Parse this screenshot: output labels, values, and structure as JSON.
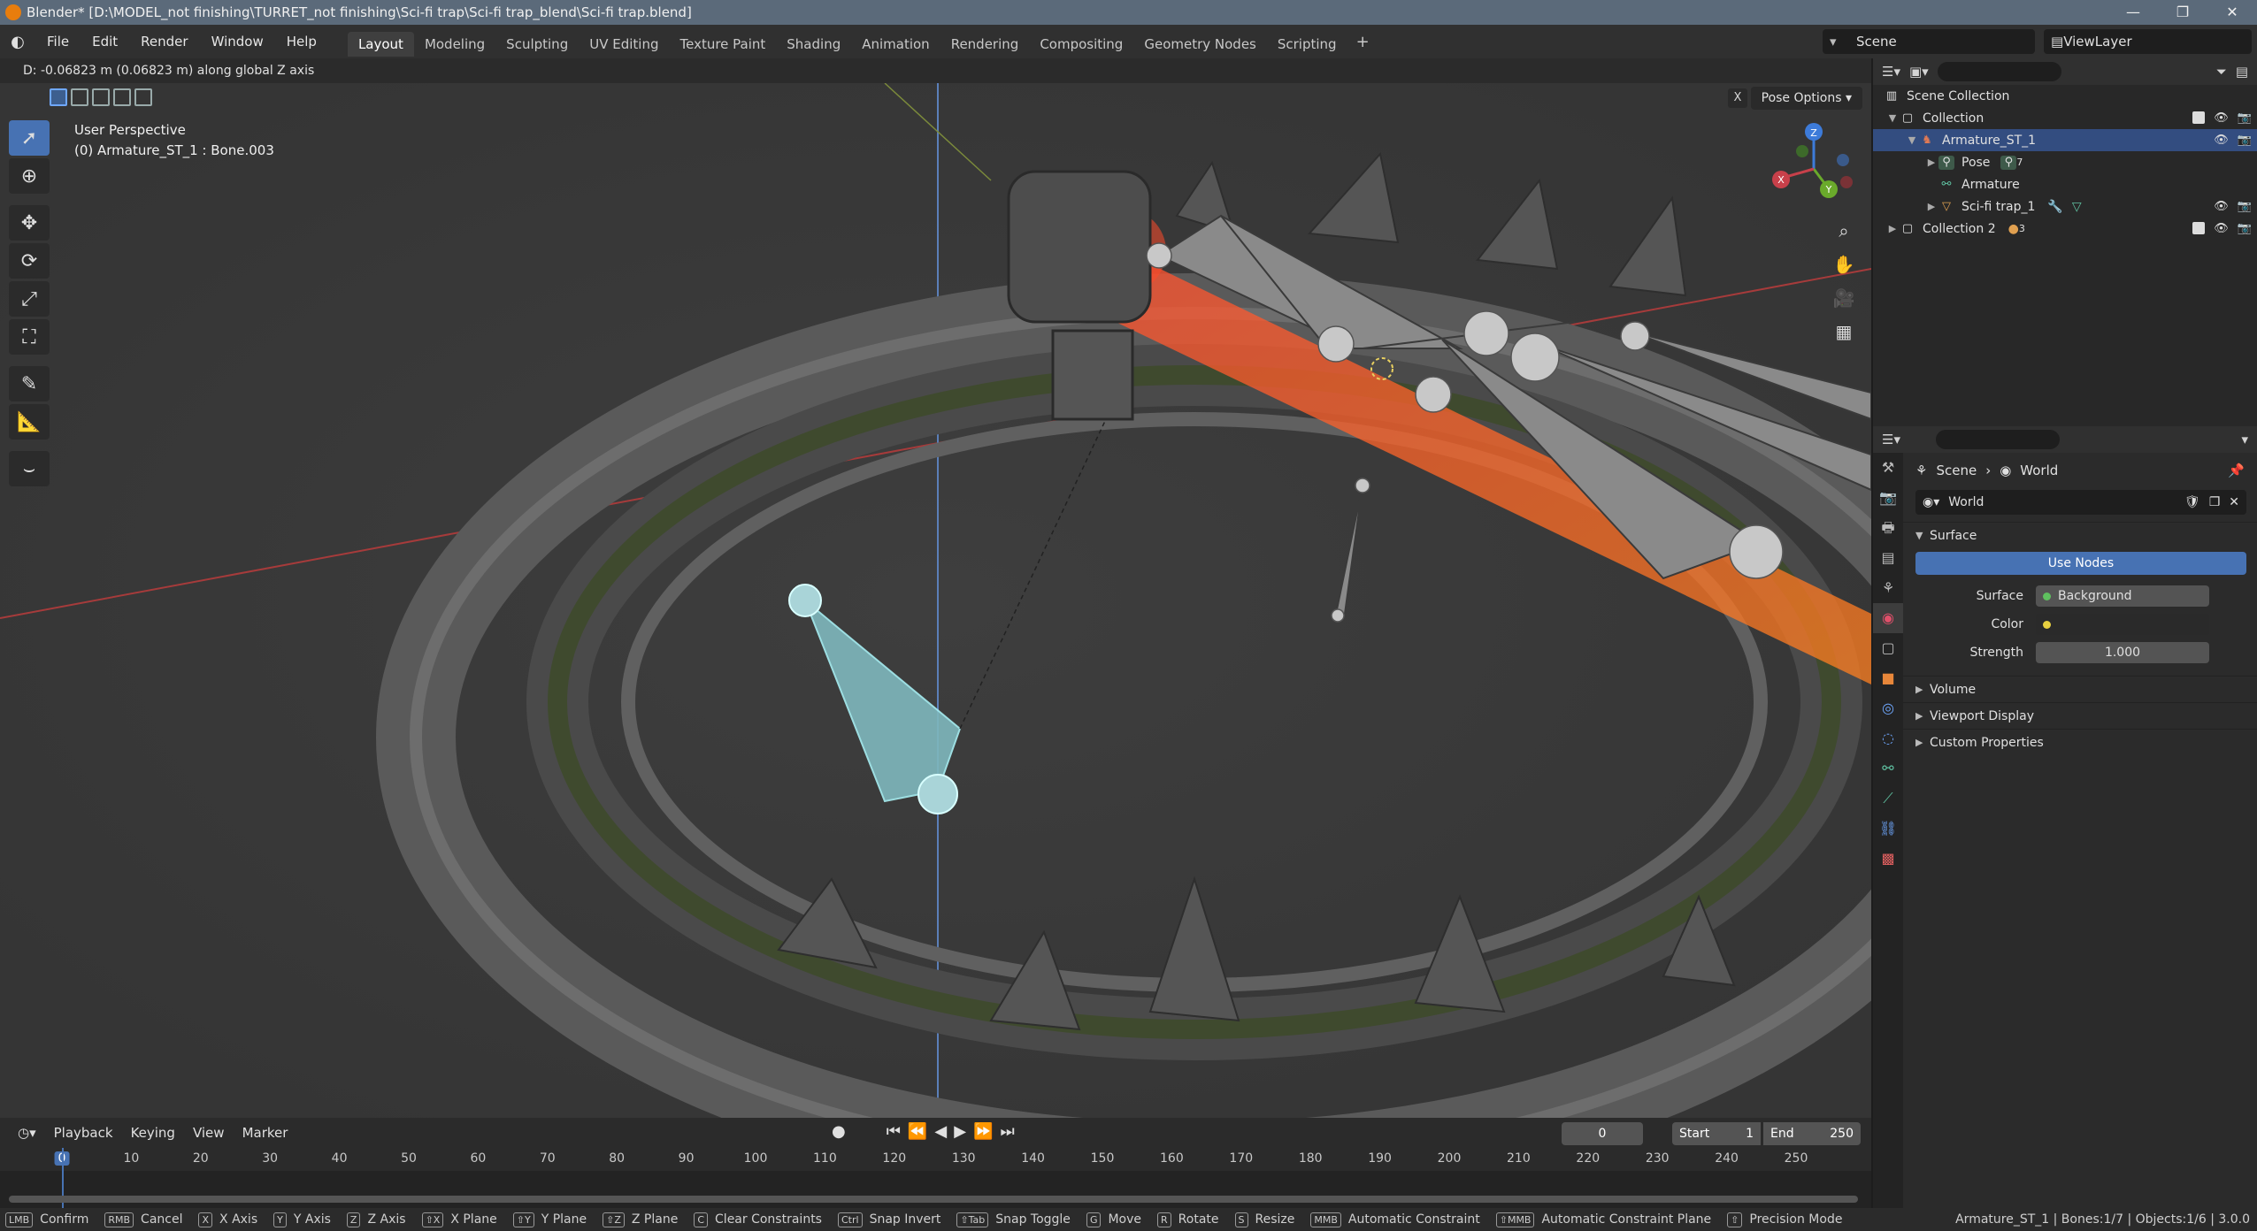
{
  "window": {
    "title": "Blender* [D:\\MODEL_not finishing\\TURRET_not finishing\\Sci-fi trap\\Sci-fi trap_blend\\Sci-fi trap.blend]",
    "controls": [
      "—",
      "❐",
      "✕"
    ]
  },
  "menubar": {
    "menus": [
      "File",
      "Edit",
      "Render",
      "Window",
      "Help"
    ],
    "workspaces": [
      "Layout",
      "Modeling",
      "Sculpting",
      "UV Editing",
      "Texture Paint",
      "Shading",
      "Animation",
      "Rendering",
      "Compositing",
      "Geometry Nodes",
      "Scripting"
    ],
    "active_workspace": "Layout",
    "add": "+",
    "scene": "Scene",
    "view_layer": "ViewLayer"
  },
  "header_status": "D: -0.06823 m (0.06823 m) along global Z axis",
  "viewport": {
    "perspective": "User Perspective",
    "active_bone": "(0) Armature_ST_1 : Bone.003",
    "pose_options": "Pose Options",
    "xray_label": "X",
    "gizmo": {
      "x": "X",
      "y": "Y",
      "z": "Z"
    }
  },
  "timeline": {
    "menus": [
      "Playback",
      "Keying",
      "View",
      "Marker"
    ],
    "current_frame": "0",
    "start_label": "Start",
    "start": "1",
    "end_label": "End",
    "end": "250",
    "ticks": [
      "0",
      "10",
      "20",
      "30",
      "40",
      "50",
      "60",
      "70",
      "80",
      "90",
      "100",
      "110",
      "120",
      "130",
      "140",
      "150",
      "160",
      "170",
      "180",
      "190",
      "200",
      "210",
      "220",
      "230",
      "240",
      "250"
    ]
  },
  "outliner": {
    "rows": [
      {
        "label": "Scene Collection"
      },
      {
        "label": "Collection"
      },
      {
        "label": "Armature_ST_1"
      },
      {
        "label": "Pose"
      },
      {
        "label": "Armature"
      },
      {
        "label": "Sci-fi trap_1"
      },
      {
        "label": "Collection 2"
      }
    ],
    "pose_badge": "7",
    "collection2_badge": "3"
  },
  "properties": {
    "breadcrumb": {
      "scene": "Scene",
      "world": "World"
    },
    "world_name": "World",
    "surface_panel": "Surface",
    "use_nodes": "Use Nodes",
    "surface_label": "Surface",
    "surface_value": "Background",
    "color_label": "Color",
    "strength_label": "Strength",
    "strength_value": "1.000",
    "panels": [
      "Volume",
      "Viewport Display",
      "Custom Properties"
    ]
  },
  "bottombar": {
    "hints": [
      {
        "key": "LMB",
        "label": "Confirm"
      },
      {
        "key": "RMB",
        "label": "Cancel"
      },
      {
        "key": "X",
        "label": "X Axis"
      },
      {
        "key": "Y",
        "label": "Y Axis"
      },
      {
        "key": "Z",
        "label": "Z Axis"
      },
      {
        "key": "⇧X",
        "label": "X Plane"
      },
      {
        "key": "⇧Y",
        "label": "Y Plane"
      },
      {
        "key": "⇧Z",
        "label": "Z Plane"
      },
      {
        "key": "C",
        "label": "Clear Constraints"
      },
      {
        "key": "Ctrl",
        "label": "Snap Invert"
      },
      {
        "key": "⇧Tab",
        "label": "Snap Toggle"
      },
      {
        "key": "G",
        "label": "Move"
      },
      {
        "key": "R",
        "label": "Rotate"
      },
      {
        "key": "S",
        "label": "Resize"
      },
      {
        "key": "MMB",
        "label": "Automatic Constraint"
      },
      {
        "key": "⇧MMB",
        "label": "Automatic Constraint Plane"
      },
      {
        "key": "⇧",
        "label": "Precision Mode"
      }
    ],
    "stats": "Armature_ST_1 | Bones:1/7 | Objects:1/6 | 3.0.0"
  },
  "colors": {
    "accent": "#4772b3",
    "title_bg": "#5b6a7a",
    "laser": "#ff3a1a",
    "selected_bone": "#7fd0d6"
  }
}
